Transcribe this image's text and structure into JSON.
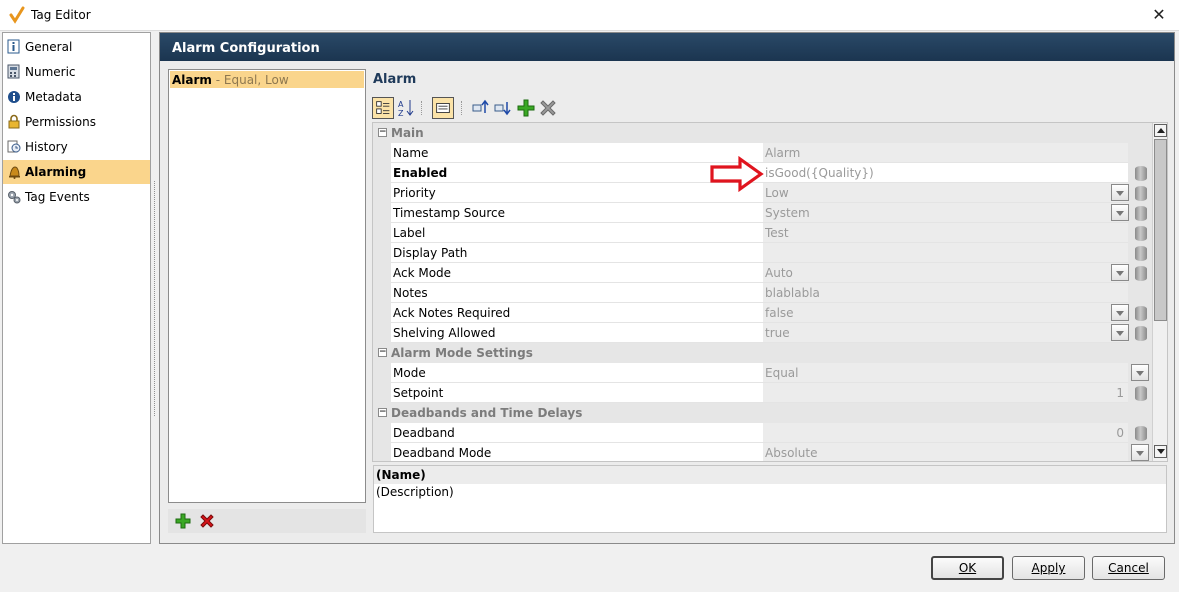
{
  "window": {
    "title": "Tag Editor",
    "close_glyph": "✕"
  },
  "nav": {
    "items": [
      {
        "label": "General",
        "icon": "info-icon"
      },
      {
        "label": "Numeric",
        "icon": "calculator-icon"
      },
      {
        "label": "Metadata",
        "icon": "info-circle-icon"
      },
      {
        "label": "Permissions",
        "icon": "lock-icon"
      },
      {
        "label": "History",
        "icon": "history-icon"
      },
      {
        "label": "Alarming",
        "icon": "bell-icon"
      },
      {
        "label": "Tag Events",
        "icon": "gears-icon"
      }
    ],
    "selected": "Alarming"
  },
  "panel": {
    "header": "Alarm Configuration",
    "section_title": "Alarm"
  },
  "alarm_list": {
    "items": [
      {
        "name": "Alarm",
        "separator": " - ",
        "desc": "Equal, Low"
      }
    ]
  },
  "grid": {
    "categories": {
      "main": "Main",
      "mode": "Alarm Mode Settings",
      "deadbands": "Deadbands and Time Delays"
    },
    "props": {
      "name": {
        "label": "Name",
        "value": "Alarm"
      },
      "enabled": {
        "label": "Enabled",
        "value": "isGood({Quality})"
      },
      "priority": {
        "label": "Priority",
        "value": "Low"
      },
      "timestamp": {
        "label": "Timestamp Source",
        "value": "System"
      },
      "label": {
        "label": "Label",
        "value": "Test"
      },
      "displaypath": {
        "label": "Display Path",
        "value": ""
      },
      "ackmode": {
        "label": "Ack Mode",
        "value": "Auto"
      },
      "notes": {
        "label": "Notes",
        "value": "blablabla"
      },
      "acknotes": {
        "label": "Ack Notes Required",
        "value": "false"
      },
      "shelving": {
        "label": "Shelving Allowed",
        "value": "true"
      },
      "mode": {
        "label": "Mode",
        "value": "Equal"
      },
      "setpoint": {
        "label": "Setpoint",
        "value": "1"
      },
      "deadband": {
        "label": "Deadband",
        "value": "0"
      },
      "deadbandmode": {
        "label": "Deadband Mode",
        "value": "Absolute"
      }
    }
  },
  "description": {
    "name": "(Name)",
    "text": "(Description)"
  },
  "buttons": {
    "ok": "OK",
    "apply": "Apply",
    "cancel": "Cancel"
  },
  "colors": {
    "header": "#1f3a56",
    "selection": "#fad58c",
    "arrow": "#e0141e"
  }
}
